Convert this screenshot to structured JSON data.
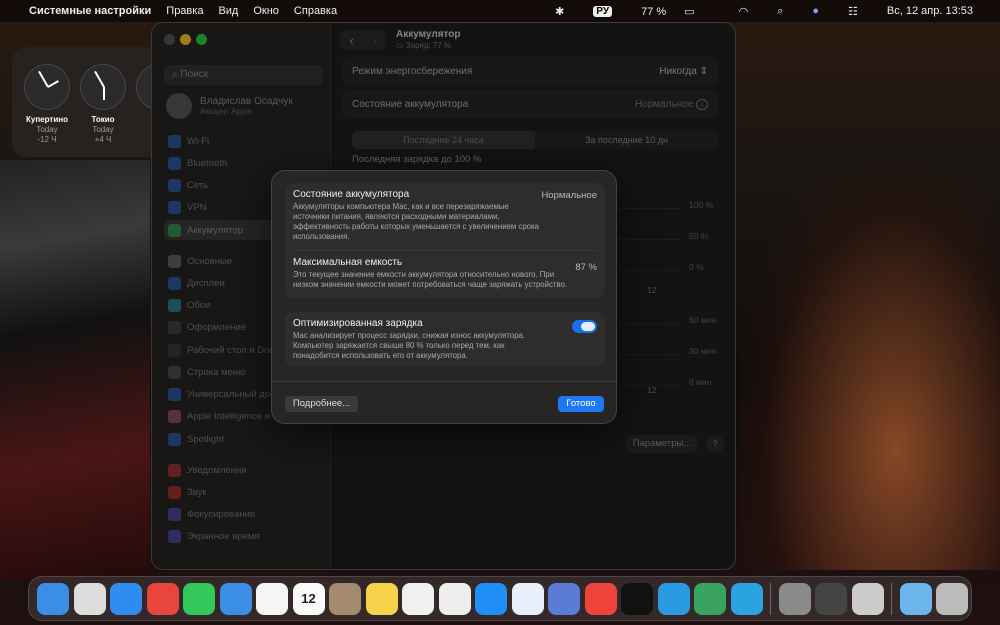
{
  "menubar": {
    "app": "Системные настройки",
    "items": [
      "Правка",
      "Вид",
      "Окно",
      "Справка"
    ],
    "lang": "РУ",
    "battery": "77 %",
    "datetime": "Вс, 12 апр.  13:53"
  },
  "widget": {
    "clocks": [
      {
        "city": "Купертино",
        "day": "Today",
        "offset": "-12 Ч"
      },
      {
        "city": "Токио",
        "day": "Today",
        "offset": "+4 Ч"
      }
    ]
  },
  "sidebar": {
    "search_placeholder": "Поиск",
    "user_name": "Владислав Осадчук",
    "user_sub": "Аккаунт Apple",
    "items": [
      {
        "label": "Wi-Fi",
        "color": "#2a7ae2"
      },
      {
        "label": "Bluetooth",
        "color": "#2a7ae2"
      },
      {
        "label": "Сеть",
        "color": "#2a7ae2"
      },
      {
        "label": "VPN",
        "color": "#2a7ae2"
      },
      {
        "label": "Аккумулятор",
        "color": "#34c759"
      },
      {
        "label": "Основные",
        "color": "#888888"
      },
      {
        "label": "Дисплеи",
        "color": "#2a7ae2"
      },
      {
        "label": "Обои",
        "color": "#30b0c7"
      },
      {
        "label": "Оформление",
        "color": "#555555"
      },
      {
        "label": "Рабочий стол и Dock",
        "color": "#444444"
      },
      {
        "label": "Строка меню",
        "color": "#666666"
      },
      {
        "label": "Универсальный доступ",
        "color": "#2a7ae2"
      },
      {
        "label": "Apple Intelligence и Siri",
        "color": "#d06090"
      },
      {
        "label": "Spotlight",
        "color": "#2a7ae2"
      },
      {
        "label": "Уведомления",
        "color": "#e53935"
      },
      {
        "label": "Звук",
        "color": "#e53935"
      },
      {
        "label": "Фокусирование",
        "color": "#5e5ce6"
      },
      {
        "label": "Экранное время",
        "color": "#5e5ce6"
      }
    ]
  },
  "content": {
    "title": "Аккумулятор",
    "subtitle": "Заряд: 77 %",
    "low_power_label": "Режим энергосбережения",
    "low_power_value": "Никогда",
    "health_label": "Состояние аккумулятора",
    "health_value": "Нормальное",
    "tabs": [
      "Последние 24 часа",
      "За последние 10 дн"
    ],
    "last_charge": "Последняя зарядка до 100 %",
    "axis_pct": [
      "100 %",
      "50 %",
      "0 %"
    ],
    "axis_min": [
      "60 мин",
      "30 мин",
      "0 мин"
    ],
    "xtick": "12",
    "params": "Параметры...",
    "help": "?"
  },
  "dialog": {
    "health_title": "Состояние аккумулятора",
    "health_value": "Нормальное",
    "health_desc": "Аккумуляторы компьютера Mac, как и все перезаряжаемые источники питания, являются расходными материалами, эффективность работы которых уменьшается с увеличением срока использования.",
    "capacity_title": "Максимальная емкость",
    "capacity_value": "87 %",
    "capacity_desc": "Это текущее значение емкости аккумулятора относительно нового. При низком значении емкости может потребоваться чаще заряжать устройство.",
    "optimized_title": "Оптимизированная зарядка",
    "optimized_on": true,
    "optimized_desc": "Mac анализирует процесс зарядки, снижая износ аккумулятора. Компьютер заряжается свыше 80 % только перед тем, как понадобится использовать его от аккумулятора.",
    "more_button": "Подробнее...",
    "done_button": "Готово",
    "accent": "#1d79f2"
  },
  "dock": {
    "calendar_day": "12",
    "items": [
      {
        "name": "finder",
        "color": "#3a8ee6"
      },
      {
        "name": "launchpad",
        "color": "#ddd"
      },
      {
        "name": "safari",
        "color": "#2f8cf0"
      },
      {
        "name": "chrome",
        "color": "#e8453c"
      },
      {
        "name": "messages",
        "color": "#34c759"
      },
      {
        "name": "mail",
        "color": "#3a8ee6"
      },
      {
        "name": "photos",
        "color": "#f5f5f5"
      },
      {
        "name": "calendar",
        "color": "#fafafa"
      },
      {
        "name": "contacts",
        "color": "#a58a70"
      },
      {
        "name": "notes",
        "color": "#f7d14a"
      },
      {
        "name": "freeform",
        "color": "#f0f0f0"
      },
      {
        "name": "drive",
        "color": "#eeeeee"
      },
      {
        "name": "app-store",
        "color": "#1f8ef5"
      },
      {
        "name": "analytics",
        "color": "#e8eefc"
      },
      {
        "name": "app",
        "color": "#5a7bd6"
      },
      {
        "name": "anydesk",
        "color": "#ef443b"
      },
      {
        "name": "tradingview",
        "color": "#111111"
      },
      {
        "name": "app",
        "color": "#2a9be0"
      },
      {
        "name": "stack",
        "color": "#3aa360"
      },
      {
        "name": "telegram",
        "color": "#2aa3e0"
      },
      {
        "name": "system-settings",
        "color": "#8a8a8a"
      },
      {
        "name": "calculator",
        "color": "#444444"
      },
      {
        "name": "app",
        "color": "#ccc"
      },
      {
        "name": "downloads-folder",
        "color": "#6ab6ec"
      },
      {
        "name": "trash",
        "color": "#bbbbbb"
      }
    ]
  }
}
